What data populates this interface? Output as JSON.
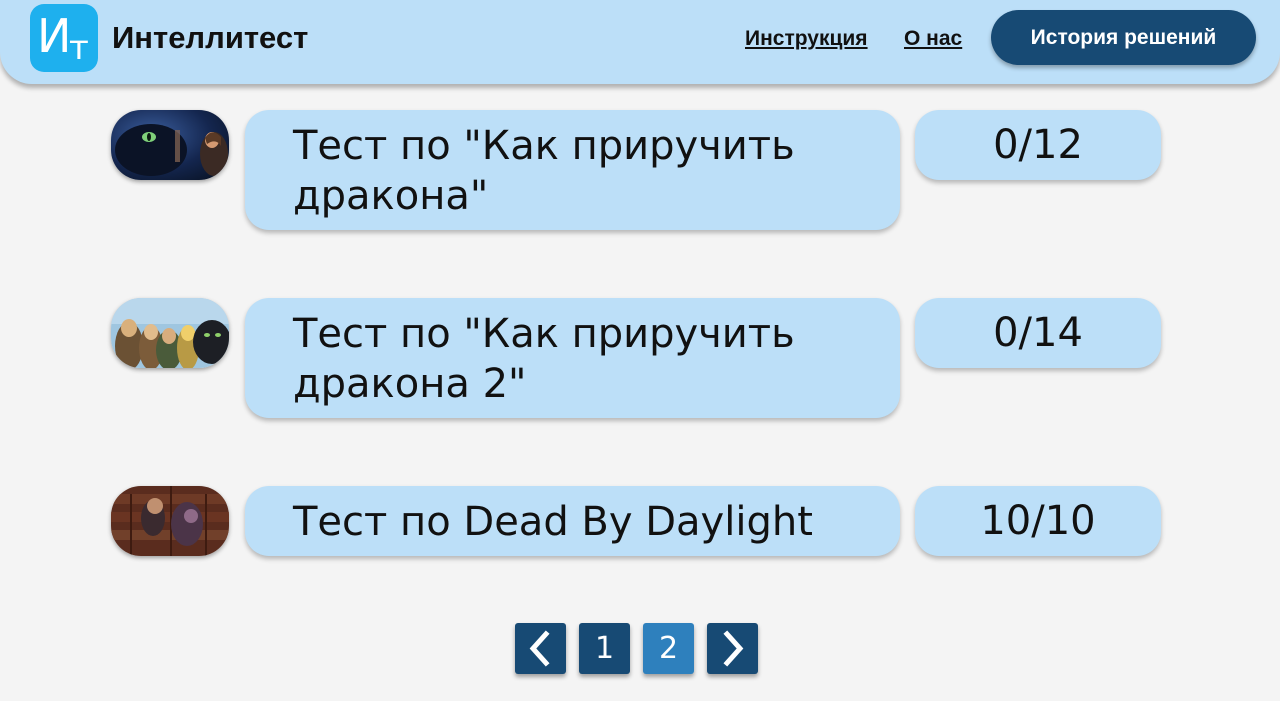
{
  "header": {
    "logo": {
      "letter_main": "И",
      "letter_sub": "т"
    },
    "brand": "Интеллитест",
    "nav": {
      "instructions": "Инструкция",
      "about": "О нас"
    },
    "history_button": "История решений"
  },
  "tests": [
    {
      "title": "Тест по \"Как приручить дракона\"",
      "score": "0/12",
      "thumb": "dragon-night-thumbnail"
    },
    {
      "title": "Тест по \"Как приручить дракона 2\"",
      "score": "0/14",
      "thumb": "dragon-group-thumbnail"
    },
    {
      "title": "Тест по Dead By Daylight",
      "score": "10/10",
      "thumb": "dead-by-daylight-thumbnail"
    }
  ],
  "pagination": {
    "prev_icon": "chevron-left-icon",
    "next_icon": "chevron-right-icon",
    "pages": [
      "1",
      "2"
    ],
    "current_page": "2"
  },
  "colors": {
    "header_bg": "#bcdff8",
    "card_bg": "#bcdff8",
    "primary_dark": "#174a74",
    "active_page": "#2e80bd",
    "logo_bg": "#1eb0ee",
    "page_bg": "#f4f4f4"
  }
}
